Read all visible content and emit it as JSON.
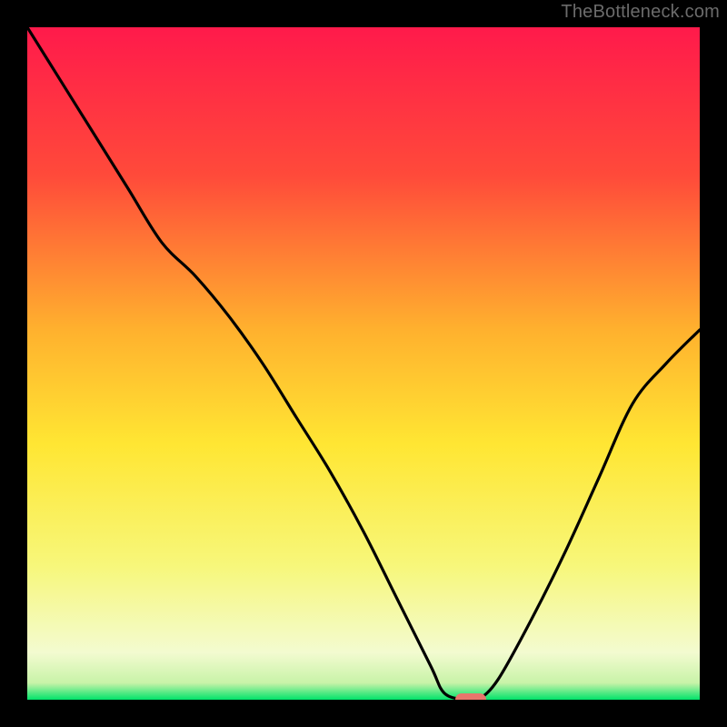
{
  "watermark": "TheBottleneck.com",
  "colors": {
    "top": "#ff1a4b",
    "mid_upper": "#ff7a2e",
    "mid": "#ffd633",
    "mid_lower": "#f7f77a",
    "pale": "#f6fbd6",
    "green": "#00e36a",
    "curve": "#000000",
    "frame": "#000000",
    "marker": "#e8766c"
  },
  "chart_data": {
    "type": "line",
    "title": "",
    "xlabel": "",
    "ylabel": "",
    "xlim": [
      0,
      100
    ],
    "ylim": [
      0,
      100
    ],
    "x": [
      0,
      5,
      10,
      15,
      20,
      25,
      30,
      35,
      40,
      45,
      50,
      55,
      60,
      62,
      65,
      67,
      70,
      75,
      80,
      85,
      90,
      95,
      100
    ],
    "values": [
      100,
      92,
      84,
      76,
      68,
      63,
      57,
      50,
      42,
      34,
      25,
      15,
      5,
      1,
      0,
      0,
      3,
      12,
      22,
      33,
      44,
      50,
      55
    ],
    "marker": {
      "x": 66,
      "y": 0
    },
    "gradient_stops": [
      {
        "offset": 0.0,
        "color": "#ff1a4b"
      },
      {
        "offset": 0.22,
        "color": "#ff4a3a"
      },
      {
        "offset": 0.45,
        "color": "#ffb12e"
      },
      {
        "offset": 0.62,
        "color": "#ffe633"
      },
      {
        "offset": 0.8,
        "color": "#f7f77a"
      },
      {
        "offset": 0.93,
        "color": "#f3fbd0"
      },
      {
        "offset": 0.975,
        "color": "#c8f3a8"
      },
      {
        "offset": 1.0,
        "color": "#00e36a"
      }
    ]
  }
}
